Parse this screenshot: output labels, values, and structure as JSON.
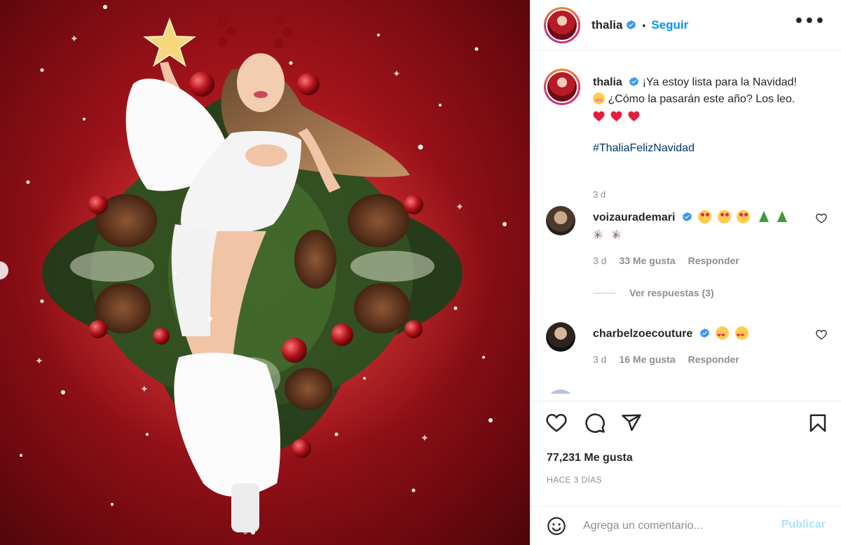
{
  "media": {
    "carousel_dots": 2,
    "active_dot": 1
  },
  "header": {
    "username": "thalia",
    "separator": "•",
    "follow_label": "Seguir",
    "more_label": "•••"
  },
  "caption": {
    "username": "thalia",
    "text_line1": "¡Ya estoy lista para la Navidad!",
    "text_line2": "¿Cómo la pasarán este año? Los leo.",
    "hearts_count": 3,
    "hashtag": "#ThaliaFelizNavidad",
    "time": "3 d"
  },
  "comments": [
    {
      "username": "voizaurademari",
      "emojis": [
        "hugging-face",
        "hugging-face",
        "hugging-face",
        "christmas-tree",
        "christmas-tree"
      ],
      "second_line": "🪅 🪅",
      "time": "3 d",
      "likes": "33 Me gusta",
      "reply_label": "Responder",
      "view_replies": "Ver respuestas (3)"
    },
    {
      "username": "charbelzoecouture",
      "emojis": [
        "heart-eyes",
        "heart-eyes"
      ],
      "time": "3 d",
      "likes": "16 Me gusta",
      "reply_label": "Responder"
    }
  ],
  "actions": {
    "icons": [
      "heart-icon",
      "comment-icon",
      "share-icon",
      "bookmark-icon"
    ]
  },
  "stats": {
    "likes": "77,231 Me gusta",
    "date": "HACE 3 DÍAS"
  },
  "add_comment": {
    "placeholder": "Agrega un comentario...",
    "publish_label": "Publicar"
  },
  "colors": {
    "accent": "#0095f6",
    "verified": "#3897f0",
    "publish_disabled": "#b2dffc",
    "muted": "#8e8e8e",
    "media_red": "#a5141c"
  }
}
